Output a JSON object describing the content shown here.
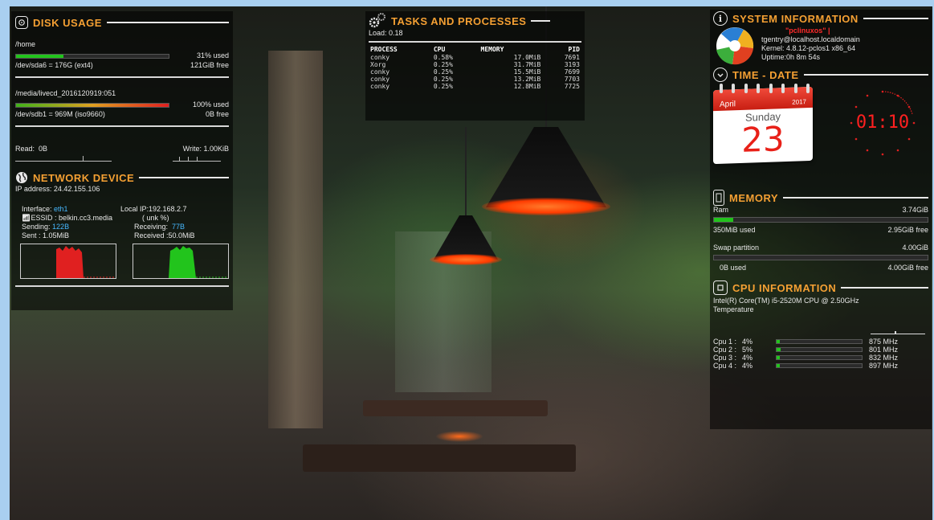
{
  "disk": {
    "title": "DISK USAGE",
    "home": {
      "path": "/home",
      "device": "/dev/sda6 = 176G (ext4)",
      "used": "31% used",
      "free": "121GiB free",
      "percent": 31
    },
    "live": {
      "path": "/media/livecd_2016120919:051",
      "device": "/dev/sdb1 = 969M (iso9660)",
      "used": "100% used",
      "free": "0B  free",
      "percent": 100
    },
    "read_label": "Read:",
    "read_value": "0B",
    "write_label": "Write: 1.00KiB"
  },
  "network": {
    "title": "NETWORK DEVICE",
    "ip": "IP address: 24.42.155.106",
    "interface_label": "Interface:",
    "interface": "eth1",
    "local_ip": "Local IP:192.168.2.7",
    "essid": "ESSID : belkin.cc3.media",
    "unk": "( unk %)",
    "sending_label": "Sending:",
    "sending": "122B",
    "receiving_label": "Receiving:",
    "receiving": "77B",
    "sent": "Sent : 1.05MiB",
    "received": "Received :50.0MiB"
  },
  "tasks": {
    "title": "TASKS AND PROCESSES",
    "load": "Load: 0.18",
    "headers": [
      "PROCESS",
      "CPU",
      "MEMORY",
      "PID"
    ],
    "rows": [
      [
        "conky",
        "0.58%",
        "17.0MiB",
        "7691"
      ],
      [
        "Xorg",
        "0.25%",
        "31.7MiB",
        "3193"
      ],
      [
        "conky",
        "0.25%",
        "15.5MiB",
        "7699"
      ],
      [
        "conky",
        "0.25%",
        "13.2MiB",
        "7703"
      ],
      [
        "conky",
        "0.25%",
        "12.8MiB",
        "7725"
      ]
    ]
  },
  "sysinfo": {
    "title": "SYSTEM INFORMATION",
    "name": "\"pclinuxos\" |",
    "host": "tgentry@localhost.localdomain",
    "kernel": "Kernel: 4.8.12-pclos1 x86_64",
    "uptime": "Uptime:0h 8m 54s"
  },
  "timedate": {
    "title": "TIME - DATE",
    "month": "April",
    "year": "2017",
    "weekday": "Sunday",
    "day": "23",
    "clock": "01:10"
  },
  "memory": {
    "title": "MEMORY",
    "ram_label": "Ram",
    "ram_total": "3.74GiB",
    "ram_used": "350MiB used",
    "ram_free": "2.95GiB free",
    "ram_percent": 9,
    "swap_label": "Swap partition",
    "swap_total": "4.00GiB",
    "swap_used": "0B  used",
    "swap_free": "4.00GiB free",
    "swap_percent": 0
  },
  "cpu": {
    "title": "CPU INFORMATION",
    "model": "Intel(R) Core(TM) i5-2520M CPU @ 2.50GHz",
    "temp_label": "Temperature",
    "cores": [
      {
        "label": "Cpu 1 :",
        "pct": "4%",
        "pct_value": 4,
        "mhz": "875 MHz"
      },
      {
        "label": "Cpu 2 :",
        "pct": "5%",
        "pct_value": 5,
        "mhz": "801 MHz"
      },
      {
        "label": "Cpu 3 :",
        "pct": "4%",
        "pct_value": 4,
        "mhz": "832 MHz"
      },
      {
        "label": "Cpu 4 :",
        "pct": "4%",
        "pct_value": 4,
        "mhz": "897 MHz"
      }
    ]
  },
  "colors": {
    "accent": "#f5a033",
    "bar_green": "#22c41c",
    "bar_red": "#e02020",
    "link": "#46b8ff"
  }
}
